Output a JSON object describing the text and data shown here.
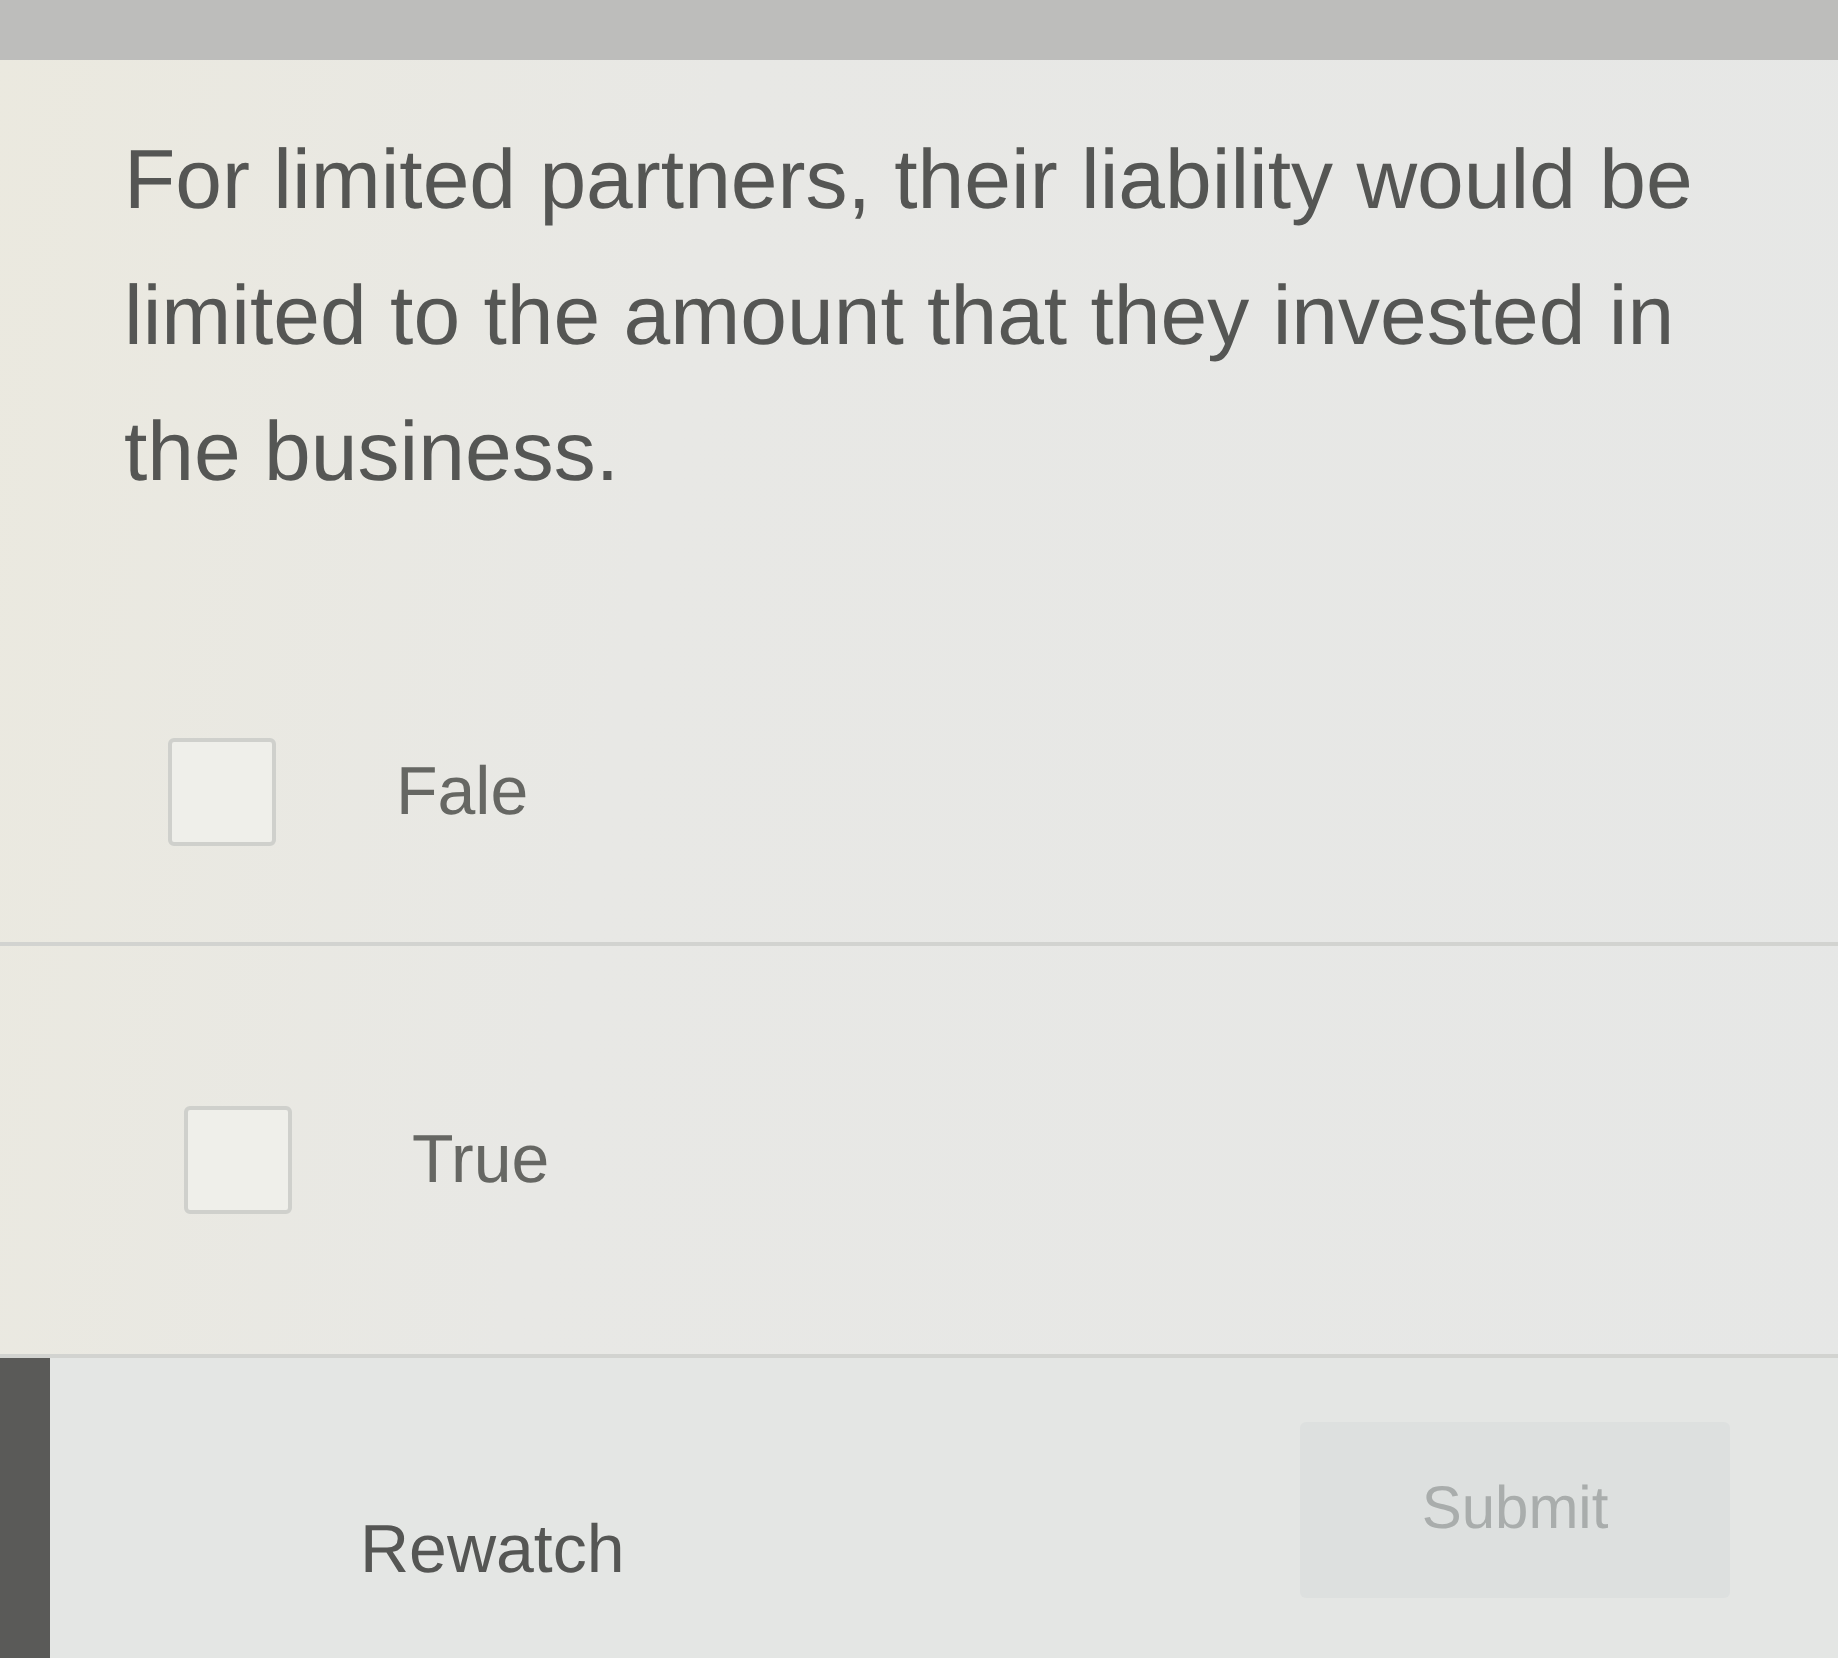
{
  "question": {
    "text": "For limited partners, their liability would be limited to the amount that they invested in the business."
  },
  "options": [
    {
      "label": "Fale",
      "checked": false
    },
    {
      "label": "True",
      "checked": false
    }
  ],
  "actions": {
    "rewatch": {
      "label": "Rewatch"
    },
    "submit": {
      "label": "Submit",
      "disabled": true
    }
  }
}
